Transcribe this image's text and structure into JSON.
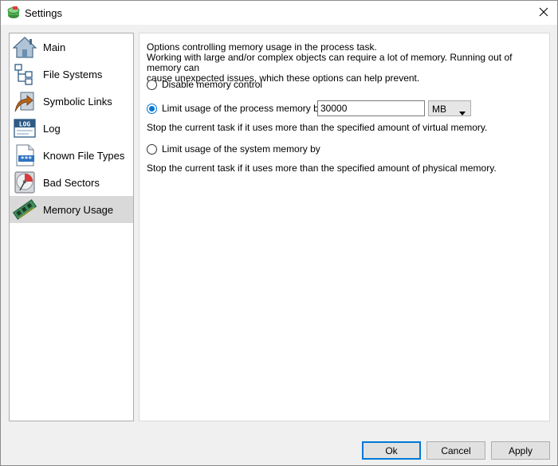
{
  "window": {
    "title": "Settings"
  },
  "sidebar": {
    "items": [
      {
        "label": "Main",
        "icon": "house-icon",
        "selected": false
      },
      {
        "label": "File Systems",
        "icon": "tree-icon",
        "selected": false
      },
      {
        "label": "Symbolic Links",
        "icon": "symlink-icon",
        "selected": false
      },
      {
        "label": "Log",
        "icon": "log-icon",
        "selected": false
      },
      {
        "label": "Known File Types",
        "icon": "file-type-icon",
        "selected": false
      },
      {
        "label": "Bad Sectors",
        "icon": "disk-icon",
        "selected": false
      },
      {
        "label": "Memory Usage",
        "icon": "memory-chip-icon",
        "selected": true
      }
    ]
  },
  "content": {
    "description_line1": "Options controlling memory usage in the process task.",
    "description_line2": "Working with large and/or complex objects can require a lot of memory. Running out of memory can",
    "description_line3": "cause unexpected issues, which these options can help prevent.",
    "options": [
      {
        "label": "Disable memory control",
        "checked": false
      },
      {
        "label": "Limit usage of the process memory by",
        "checked": true
      },
      {
        "label": "Limit usage of the system memory by",
        "checked": false
      }
    ],
    "process_memory_value": "30000",
    "unit": "MB",
    "process_note": "Stop the current task if it uses more than the specified amount of virtual memory.",
    "system_note": "Stop the current task if it uses more than the specified amount of physical memory."
  },
  "buttons": {
    "ok": "Ok",
    "cancel": "Cancel",
    "apply": "Apply"
  },
  "colors": {
    "accent": "#0078d7",
    "selected_item_bg": "#d9d9d9",
    "window_bg": "#f0f0f0"
  }
}
